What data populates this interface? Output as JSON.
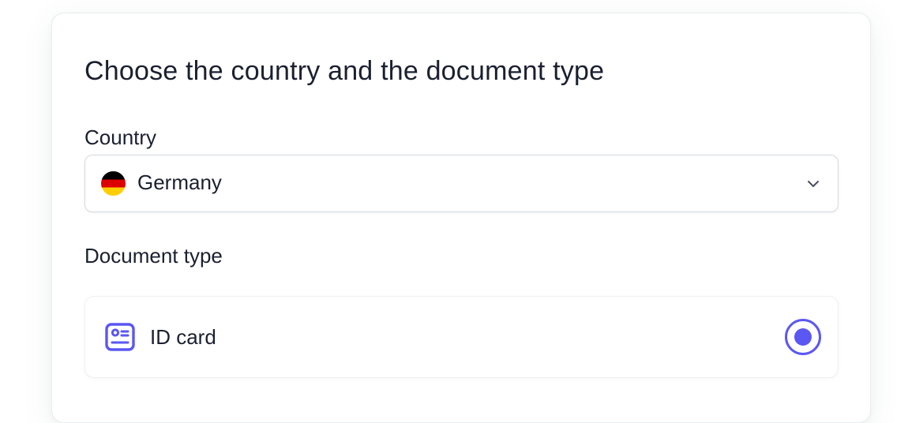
{
  "form": {
    "title": "Choose the country and the document type",
    "country_label": "Country",
    "country_select": {
      "value": "Germany",
      "flag_icon": "germany-flag-icon",
      "dropdown_icon": "chevron-down-icon"
    },
    "document_type_label": "Document type",
    "document_options": [
      {
        "label": "ID card",
        "icon": "id-card-icon",
        "selected": true
      }
    ]
  },
  "colors": {
    "accent": "#5b57f2",
    "text": "#1b2030",
    "border": "#d5d9df",
    "flag_black": "#000000",
    "flag_red": "#dd0000",
    "flag_gold": "#ffce00"
  }
}
